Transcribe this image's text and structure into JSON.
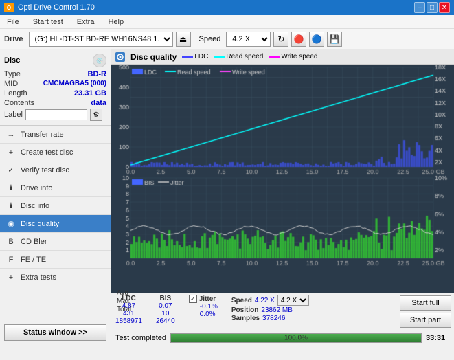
{
  "app": {
    "title": "Opti Drive Control 1.70",
    "icon": "O"
  },
  "titlebar": {
    "minimize": "–",
    "maximize": "□",
    "close": "✕"
  },
  "menu": {
    "items": [
      "File",
      "Start test",
      "Extra",
      "Help"
    ]
  },
  "toolbar": {
    "drive_label": "Drive",
    "drive_value": "(G:)  HL-DT-ST BD-RE  WH16NS48 1.D3",
    "speed_label": "Speed",
    "speed_value": "4.2 X"
  },
  "disc": {
    "title": "Disc",
    "type_label": "Type",
    "type_value": "BD-R",
    "mid_label": "MID",
    "mid_value": "CMCMAGBA5 (000)",
    "length_label": "Length",
    "length_value": "23.31 GB",
    "contents_label": "Contents",
    "contents_value": "data",
    "label_label": "Label",
    "label_value": ""
  },
  "nav": {
    "items": [
      {
        "id": "transfer-rate",
        "label": "Transfer rate",
        "icon": "→"
      },
      {
        "id": "create-test-disc",
        "label": "Create test disc",
        "icon": "+"
      },
      {
        "id": "verify-test-disc",
        "label": "Verify test disc",
        "icon": "✓"
      },
      {
        "id": "drive-info",
        "label": "Drive info",
        "icon": "i"
      },
      {
        "id": "disc-info",
        "label": "Disc info",
        "icon": "i"
      },
      {
        "id": "disc-quality",
        "label": "Disc quality",
        "icon": "◉",
        "active": true
      },
      {
        "id": "cd-bler",
        "label": "CD Bler",
        "icon": "B"
      },
      {
        "id": "fe-te",
        "label": "FE / TE",
        "icon": "F"
      },
      {
        "id": "extra-tests",
        "label": "Extra tests",
        "icon": "+"
      }
    ],
    "status_btn": "Status window >>"
  },
  "chart": {
    "title": "Disc quality",
    "icon": "◈",
    "legend": {
      "ldc_label": "LDC",
      "ldc_color": "#4444ff",
      "read_label": "Read speed",
      "read_color": "#00ffff",
      "write_label": "Write speed",
      "write_color": "#ff00ff"
    },
    "legend2": {
      "bis_label": "BIS",
      "bis_color": "#4444ff",
      "jitter_label": "Jitter",
      "jitter_color": "#cccccc"
    },
    "y_axis_top": [
      "500",
      "400",
      "300",
      "200",
      "100",
      "0"
    ],
    "y_axis_top_right": [
      "18X",
      "16X",
      "14X",
      "12X",
      "10X",
      "8X",
      "6X",
      "4X",
      "2X"
    ],
    "x_axis": [
      "0.0",
      "2.5",
      "5.0",
      "7.5",
      "10.0",
      "12.5",
      "15.0",
      "17.5",
      "20.0",
      "22.5",
      "25.0 GB"
    ],
    "y_axis_bottom": [
      "10",
      "9",
      "8",
      "7",
      "6",
      "5",
      "4",
      "3",
      "2",
      "1"
    ],
    "y_axis_bottom_right": [
      "10%",
      "8%",
      "6%",
      "4%",
      "2%"
    ]
  },
  "stats": {
    "ldc_header": "LDC",
    "bis_header": "BIS",
    "jitter_header": "Jitter",
    "speed_header": "Speed",
    "position_header": "Position",
    "samples_header": "Samples",
    "avg_label": "Avg",
    "avg_ldc": "4.87",
    "avg_bis": "0.07",
    "avg_jitter": "-0.1%",
    "max_label": "Max",
    "max_ldc": "431",
    "max_bis": "10",
    "max_jitter": "0.0%",
    "total_label": "Total",
    "total_ldc": "1858971",
    "total_bis": "26440",
    "speed_value": "4.22 X",
    "position_value": "23862 MB",
    "samples_value": "378246",
    "jitter_checked": true,
    "speed_select": "4.2 X"
  },
  "buttons": {
    "start_full": "Start full",
    "start_part": "Start part"
  },
  "progress": {
    "label": "Test completed",
    "percent": "100.0%",
    "fill": 100
  },
  "status_bar_time": "33:31"
}
